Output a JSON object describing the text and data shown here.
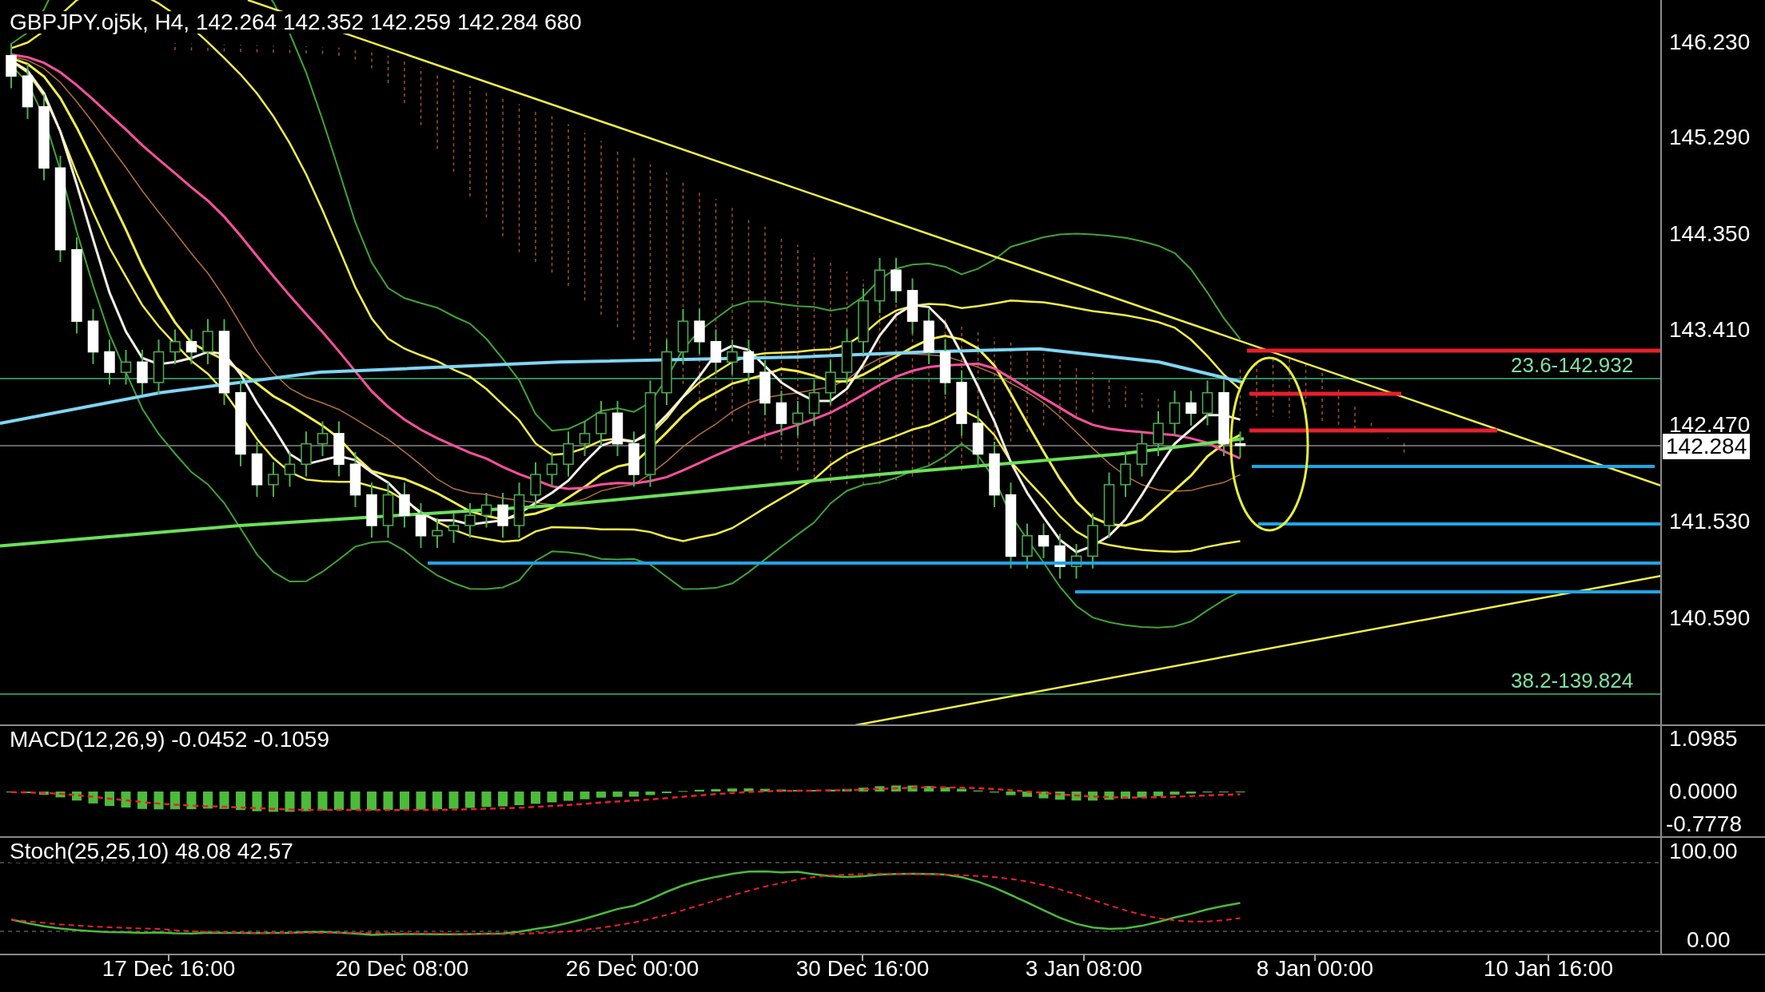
{
  "chart": {
    "title": "GBPJPY.oj5k, H4, 142.264 142.352 142.259 142.284 680",
    "price_axis": [
      "146.230",
      "145.290",
      "144.350",
      "143.410",
      "142.470",
      "141.530",
      "140.590"
    ],
    "current_price": "142.284",
    "fibonacci_labels": [
      "23.6-142.932",
      "38.2-139.824"
    ]
  },
  "macd": {
    "title": "MACD(12,26,9) -0.0452 -0.1059",
    "axis": [
      "1.0985",
      "0.0000",
      "-0.7778"
    ]
  },
  "stochastic": {
    "title": "Stoch(25,25,10) 48.08 42.57",
    "axis": [
      "100.00",
      "0.00"
    ]
  },
  "time_axis": [
    "17 Dec 16:00",
    "20 Dec 08:00",
    "26 Dec 00:00",
    "30 Dec 16:00",
    "3 Jan 08:00",
    "8 Jan 00:00",
    "10 Jan 16:00"
  ]
}
